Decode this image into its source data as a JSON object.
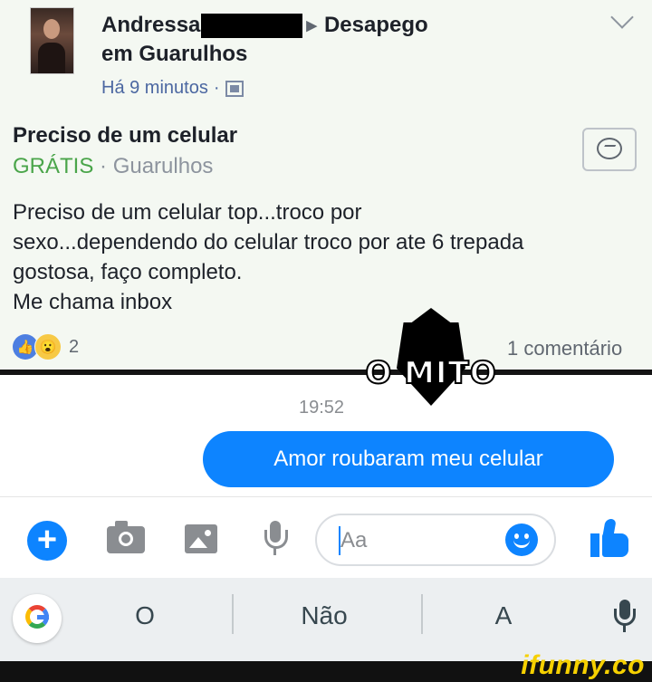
{
  "post": {
    "author_name": "Andressa",
    "group_name": "Desapego",
    "location": "em Guarulhos",
    "time_ago": "Há 9 minutos",
    "separator": "·",
    "title": "Preciso de um celular",
    "price": "GRÁTIS",
    "city": "Guarulhos",
    "body": "Preciso de um celular top...troco por\nsexo...dependendo do celular troco por ate 6 trepada\ngostosa, faço completo.\nMe chama inbox",
    "reaction_count": "2",
    "comments": "1 comentário",
    "icons": [
      "market-icon",
      "messenger-icon",
      "like-reaction-icon",
      "wow-reaction-icon",
      "chevron-down-icon"
    ]
  },
  "overlay": {
    "stamp_text": "O MITO"
  },
  "chat": {
    "timestamp": "19:52",
    "message": "Amor roubaram meu celular"
  },
  "composer": {
    "placeholder": "Aa",
    "icons": [
      "plus-icon",
      "camera-icon",
      "image-icon",
      "mic-icon",
      "emoji-icon",
      "thumbs-up-icon"
    ],
    "accent": "#0d84ff"
  },
  "keyboard": {
    "suggestions": [
      "O",
      "Não",
      "A"
    ],
    "icons": [
      "google-icon",
      "mic-icon"
    ]
  },
  "watermark": {
    "text": "ifunny.co"
  }
}
